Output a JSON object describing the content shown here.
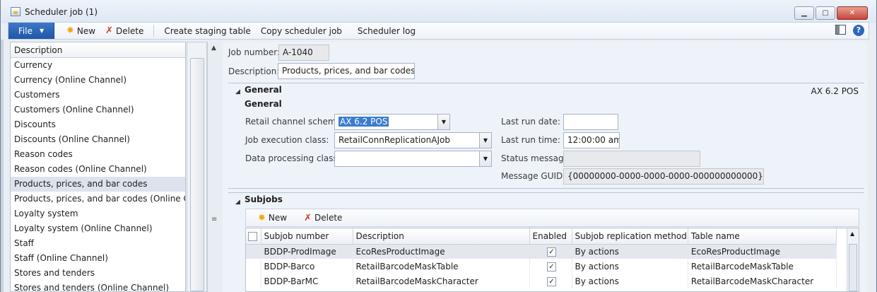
{
  "window": {
    "title": "Scheduler job (1)"
  },
  "actionbar": {
    "file_label": "File",
    "new_label": "New",
    "delete_label": "Delete",
    "create_staging_label": "Create staging table",
    "copy_job_label": "Copy scheduler job",
    "log_label": "Scheduler log"
  },
  "list": {
    "header": "Description",
    "items": [
      "Currency",
      "Currency (Online Channel)",
      "Customers",
      "Customers (Online Channel)",
      "Discounts",
      "Discounts (Online Channel)",
      "Reason codes",
      "Reason codes (Online Channel)",
      "Products, prices, and bar codes",
      "Products, prices, and bar codes (Online Ch...",
      "Loyalty system",
      "Loyalty system (Online Channel)",
      "Staff",
      "Staff (Online Channel)",
      "Stores and tenders",
      "Stores and tenders (Online Channel)"
    ],
    "selected_index": 8
  },
  "header": {
    "job_number_label": "Job number:",
    "job_number_value": "A-1040",
    "description_label": "Description:",
    "description_value": "Products, prices, and bar codes"
  },
  "general": {
    "title": "General",
    "summary": "AX 6.2 POS",
    "group_title": "General",
    "schema_label": "Retail channel schema:",
    "schema_value": "AX 6.2 POS",
    "exec_class_label": "Job execution class:",
    "exec_class_value": "RetailConnReplicationAJob",
    "data_class_label": "Data processing class:",
    "data_class_value": "",
    "last_run_date_label": "Last run date:",
    "last_run_date_value": "",
    "last_run_time_label": "Last run time:",
    "last_run_time_value": "12:00:00 am",
    "status_label": "Status message:",
    "status_value": "",
    "guid_label": "Message GUID:",
    "guid_value": "{00000000-0000-0000-0000-000000000000}"
  },
  "subjobs": {
    "title": "Subjobs",
    "new_label": "New",
    "delete_label": "Delete",
    "columns": [
      "Subjob number",
      "Description",
      "Enabled",
      "Subjob replication method",
      "Table name"
    ],
    "rows": [
      {
        "number": "BDDP-ProdImage",
        "description": "EcoResProductImage",
        "enabled": "✓",
        "method": "By actions",
        "table": "EcoResProductImage"
      },
      {
        "number": "BDDP-Barco",
        "description": "RetailBarcodeMaskTable",
        "enabled": "✓",
        "method": "By actions",
        "table": "RetailBarcodeMaskTable"
      },
      {
        "number": "BDDP-BarMC",
        "description": "RetailBarcodeMaskCharacter",
        "enabled": "✓",
        "method": "By actions",
        "table": "RetailBarcodeMaskCharacter"
      }
    ]
  },
  "icons": {
    "title": "scheduler-app-icon",
    "new": "new-sun-icon",
    "delete": "delete-x-icon",
    "layout": "layout-icon",
    "help": "help-icon"
  }
}
